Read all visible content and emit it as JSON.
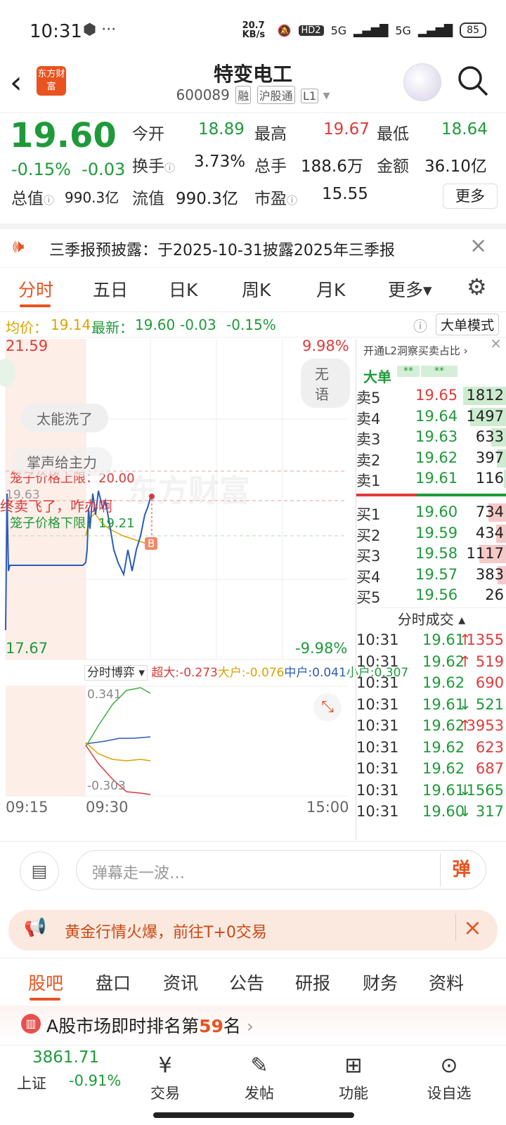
{
  "status": {
    "time": "10:31",
    "speed": "20.7 KB/s",
    "hd": "HD2",
    "net1": "5G",
    "net2": "5G",
    "battery": "85"
  },
  "header": {
    "logo": "东方财富",
    "name": "特变电工",
    "code": "600089",
    "tags": [
      "融",
      "沪股通",
      "L1"
    ]
  },
  "quote": {
    "price": "19.60",
    "change_pct": "-0.15%",
    "change": "-0.03",
    "open_label": "今开",
    "open": "18.89",
    "high_label": "最高",
    "high": "19.67",
    "low_label": "最低",
    "low": "18.64",
    "turnover_label": "换手",
    "turnover": "3.73%",
    "volume_label": "总手",
    "volume": "188.6万",
    "amount_label": "金额",
    "amount": "36.10亿",
    "mktcap_label": "总值",
    "mktcap": "990.3亿",
    "float_label": "流值",
    "float": "990.3亿",
    "pe_label": "市盈",
    "pe": "15.55",
    "more": "更多"
  },
  "notice": {
    "text": "三季报预披露：于2025-10-31披露2025年三季报"
  },
  "tabs": [
    "分时",
    "五日",
    "日K",
    "周K",
    "月K",
    "更多▾"
  ],
  "infobar": {
    "avg_label": "均价：",
    "avg": "19.14",
    "last_label": "最新：",
    "last": "19.60",
    "chg": "-0.03",
    "pct": "-0.15%",
    "mode": "大单模式"
  },
  "chart": {
    "top_price": "21.59",
    "top_pct": "9.98%",
    "bottom_price": "17.67",
    "bottom_pct": "-9.98%",
    "mid_price": "19.63",
    "upper_limit": "笼子价格上限：20.00",
    "lower_limit": "笼子价格下限：19.21",
    "watermark": "东方财富",
    "danmu": [
      "太能洗了",
      "掌声给主力",
      "终卖飞了，咋办啊",
      "无语"
    ],
    "indicator": "分时博弈 ▾",
    "ind_super": "超大:-0.273",
    "ind_big": "大户:-0.076",
    "ind_mid": "中户:0.041",
    "ind_small": "小户:0.307",
    "ind_top": "0.341",
    "ind_bottom": "-0.303",
    "times": [
      "09:15",
      "09:30",
      "15:00"
    ],
    "marker": "B"
  },
  "orderbook": {
    "promo": "开通L2洞察买卖占比 ›",
    "big_label": "大单",
    "big_stars": "**",
    "big_stars2": "**",
    "asks": [
      {
        "l": "卖5",
        "p": "19.65",
        "v": "1812",
        "w": 62
      },
      {
        "l": "卖4",
        "p": "19.64",
        "v": "1497",
        "w": 52
      },
      {
        "l": "卖3",
        "p": "19.63",
        "v": "633",
        "w": 22
      },
      {
        "l": "卖2",
        "p": "19.62",
        "v": "397",
        "w": 14
      },
      {
        "l": "卖1",
        "p": "19.61",
        "v": "116",
        "w": 4
      }
    ],
    "bids": [
      {
        "l": "买1",
        "p": "19.60",
        "v": "734",
        "w": 26
      },
      {
        "l": "买2",
        "p": "19.59",
        "v": "434",
        "w": 15
      },
      {
        "l": "买3",
        "p": "19.58",
        "v": "1117",
        "w": 39
      },
      {
        "l": "买4",
        "p": "19.57",
        "v": "383",
        "w": 13
      },
      {
        "l": "买5",
        "p": "19.56",
        "v": "26",
        "w": 1
      }
    ],
    "trades_title": "分时成交",
    "trades": [
      {
        "t": "10:31",
        "p": "19.61",
        "v": "1355",
        "d": "↑"
      },
      {
        "t": "10:31",
        "p": "19.62",
        "v": "519",
        "d": "↑"
      },
      {
        "t": "10:31",
        "p": "19.62",
        "v": "690",
        "d": ""
      },
      {
        "t": "10:31",
        "p": "19.61",
        "v": "521",
        "d": "↓"
      },
      {
        "t": "10:31",
        "p": "19.62",
        "v": "3953",
        "d": "↑"
      },
      {
        "t": "10:31",
        "p": "19.62",
        "v": "623",
        "d": ""
      },
      {
        "t": "10:31",
        "p": "19.62",
        "v": "687",
        "d": ""
      },
      {
        "t": "10:31",
        "p": "19.61",
        "v": "1565",
        "d": "↓"
      },
      {
        "t": "10:31",
        "p": "19.60",
        "v": "317",
        "d": "↓"
      }
    ]
  },
  "danmu_input": {
    "placeholder": "弹幕走一波…",
    "button": "弹"
  },
  "gold": {
    "text": "黄金行情火爆，前往T+0交易"
  },
  "bottom_tabs": [
    "股吧",
    "盘口",
    "资讯",
    "公告",
    "研报",
    "财务",
    "资料"
  ],
  "rank": {
    "prefix": "A股市场即时排名第",
    "num": "59",
    "suffix": "名"
  },
  "footer": {
    "index_value": "3861.71",
    "index_name": "上证",
    "index_pct": "-0.91%",
    "items": [
      "交易",
      "发帖",
      "功能",
      "设自选"
    ]
  }
}
